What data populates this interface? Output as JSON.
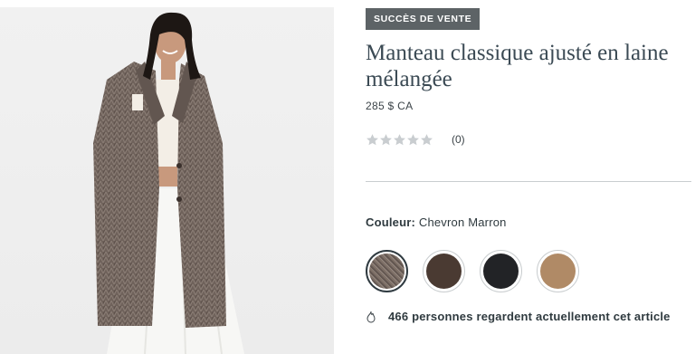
{
  "product": {
    "badge": "SUCCÈS DE VENTE",
    "title": "Manteau classique ajusté en laine mélangée",
    "price": "285 $ CA",
    "rating_stars": 0,
    "rating_count": "(0)",
    "image_alt": "Femme portant un manteau long en laine chevron marron"
  },
  "color": {
    "label": "Couleur:",
    "selected_name": "Chevron Marron",
    "swatches": [
      {
        "name": "Chevron Marron",
        "color": "#7a6b62",
        "selected": true
      },
      {
        "name": "Brun foncé",
        "color": "#4a3a32",
        "selected": false
      },
      {
        "name": "Noir",
        "color": "#222326",
        "selected": false
      },
      {
        "name": "Camel",
        "color": "#b08a66",
        "selected": false
      }
    ]
  },
  "social_proof": {
    "icon": "flame-icon",
    "text": "466 personnes regardent actuellement cet article"
  },
  "colors": {
    "badge_bg": "#5d6366",
    "title_text": "#3b4a54",
    "divider": "#c9cdd0",
    "star_empty": "#c9cdd0"
  }
}
